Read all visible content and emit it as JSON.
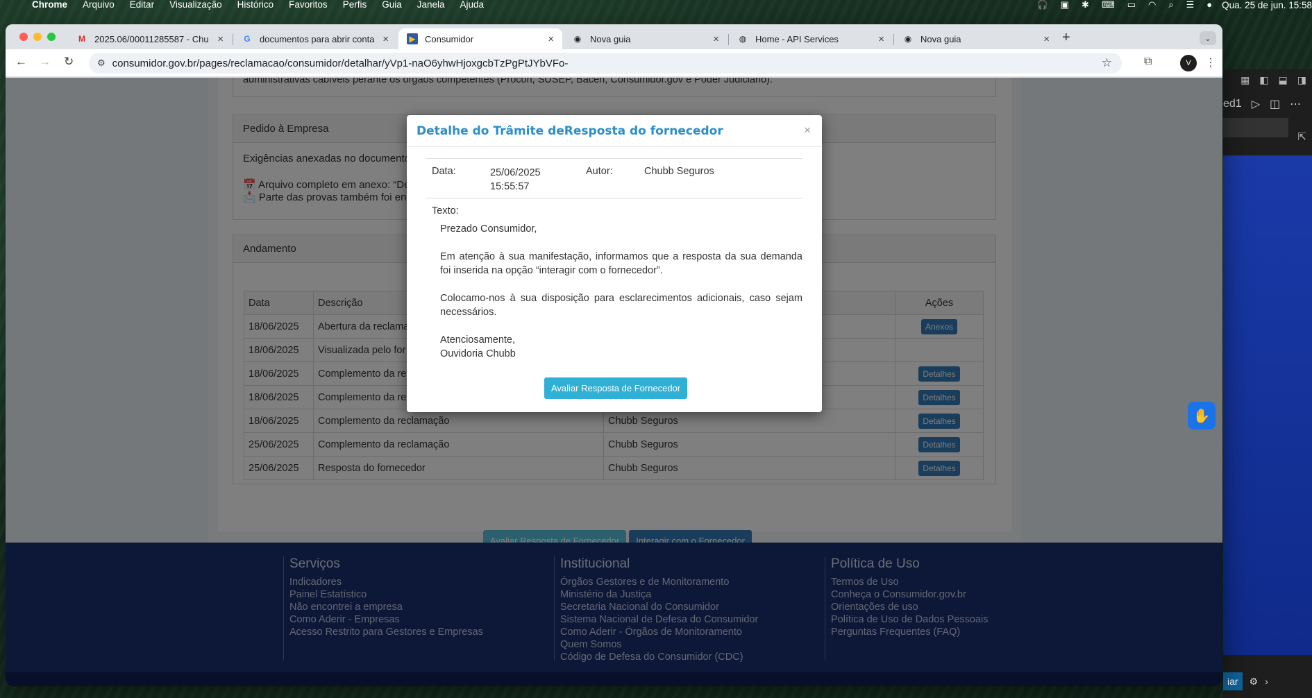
{
  "menubar": {
    "app": "Chrome",
    "items": [
      "Arquivo",
      "Editar",
      "Visualização",
      "Histórico",
      "Favoritos",
      "Perfis",
      "Guia",
      "Janela",
      "Ajuda"
    ],
    "clock": "Qua. 25 de jun.  15:58"
  },
  "browser": {
    "tabs": [
      {
        "title": "2025.06/00011285587 - Chu",
        "icon": "gmail-icon"
      },
      {
        "title": "documentos para abrir conta",
        "icon": "google-icon"
      },
      {
        "title": "Consumidor",
        "icon": "consumidor-icon"
      },
      {
        "title": "Nova guia",
        "icon": "chrome-icon"
      },
      {
        "title": "Home - API Services",
        "icon": "globe-icon"
      },
      {
        "title": "Nova guia",
        "icon": "chrome-icon"
      }
    ],
    "url": "consumidor.gov.br/pages/reclamacao/consumidor/detalhar/yVp1-naO6yhwHjoxgcbTzPgPtJYbVFo-"
  },
  "page": {
    "top_text": "administrativas cabíveis perante os órgãos competentes (Procon, SUSEP, Bacen, Consumidor.gov e Poder Judiciário).",
    "pedido": {
      "header": "Pedido à Empresa",
      "line1": "Exigências anexadas no documento",
      "line2": "📅 Arquivo completo em anexo: “De",
      "line3": "📩 Parte das provas também foi env"
    },
    "andamento": {
      "header": "Andamento",
      "columns": [
        "Data",
        "Descrição",
        "",
        "Ações"
      ],
      "rows": [
        {
          "data": "18/06/2025",
          "descricao": "Abertura da reclama",
          "autor": "",
          "acao": "Anexos"
        },
        {
          "data": "18/06/2025",
          "descricao": "Visualizada pelo for",
          "autor": "",
          "acao": ""
        },
        {
          "data": "18/06/2025",
          "descricao": "Complemento da re",
          "autor": "",
          "acao": "Detalhes"
        },
        {
          "data": "18/06/2025",
          "descricao": "Complemento da re",
          "autor": "",
          "acao": "Detalhes"
        },
        {
          "data": "18/06/2025",
          "descricao": "Complemento da reclamação",
          "autor": "Chubb Seguros",
          "acao": "Detalhes"
        },
        {
          "data": "25/06/2025",
          "descricao": "Complemento da reclamação",
          "autor": "Chubb Seguros",
          "acao": "Detalhes"
        },
        {
          "data": "25/06/2025",
          "descricao": "Resposta do fornecedor",
          "autor": "Chubb Seguros",
          "acao": "Detalhes"
        }
      ]
    },
    "buttons": {
      "avaliar": "Avaliar Resposta de Fornecedor",
      "interagir": "Interagir com o Fornecedor"
    }
  },
  "footer": {
    "servicos": {
      "title": "Serviços",
      "links": [
        "Indicadores",
        "Painel Estatístico",
        "Não encontrei a empresa",
        "Como Aderir - Empresas",
        "Acesso Restrito para Gestores e Empresas"
      ]
    },
    "institucional": {
      "title": "Institucional",
      "links": [
        "Órgãos Gestores e de Monitoramento",
        "Ministério da Justiça",
        "Secretaria Nacional do Consumidor",
        "Sistema Nacional de Defesa do Consumidor",
        "Como Aderir - Órgãos de Monitoramento",
        "Quem Somos",
        "Código de Defesa do Consumidor (CDC)"
      ]
    },
    "politica": {
      "title": "Política de Uso",
      "links": [
        "Termos de Uso",
        "Conheça o Consumidor.gov.br",
        "Orientações de uso",
        "Política de Uso de Dados Pessoais",
        "Perguntas Frequentes (FAQ)"
      ]
    }
  },
  "modal": {
    "title": "Detalhe do Trâmite deResposta do fornecedor",
    "close": "×",
    "data_label": "Data:",
    "data_value": "25/06/2025 15:55:57",
    "autor_label": "Autor:",
    "autor_value": "Chubb Seguros",
    "texto_label": "Texto:",
    "texto": {
      "p1": "Prezado Consumidor,",
      "p2": "Em atenção à sua manifestação, informamos que a resposta da sua demanda foi inserida na opção “interagir com o fornecedor”.",
      "p3": "Colocamo-nos à sua disposição para esclarecimentos adicionais, caso sejam necessários.",
      "p4a": "Atenciosamente,",
      "p4b": "Ouvidoria Chubb"
    },
    "button": "Avaliar Resposta de Fornecedor"
  },
  "side_app": {
    "title_fragment": "ed1",
    "bottom_btn": "iar"
  }
}
